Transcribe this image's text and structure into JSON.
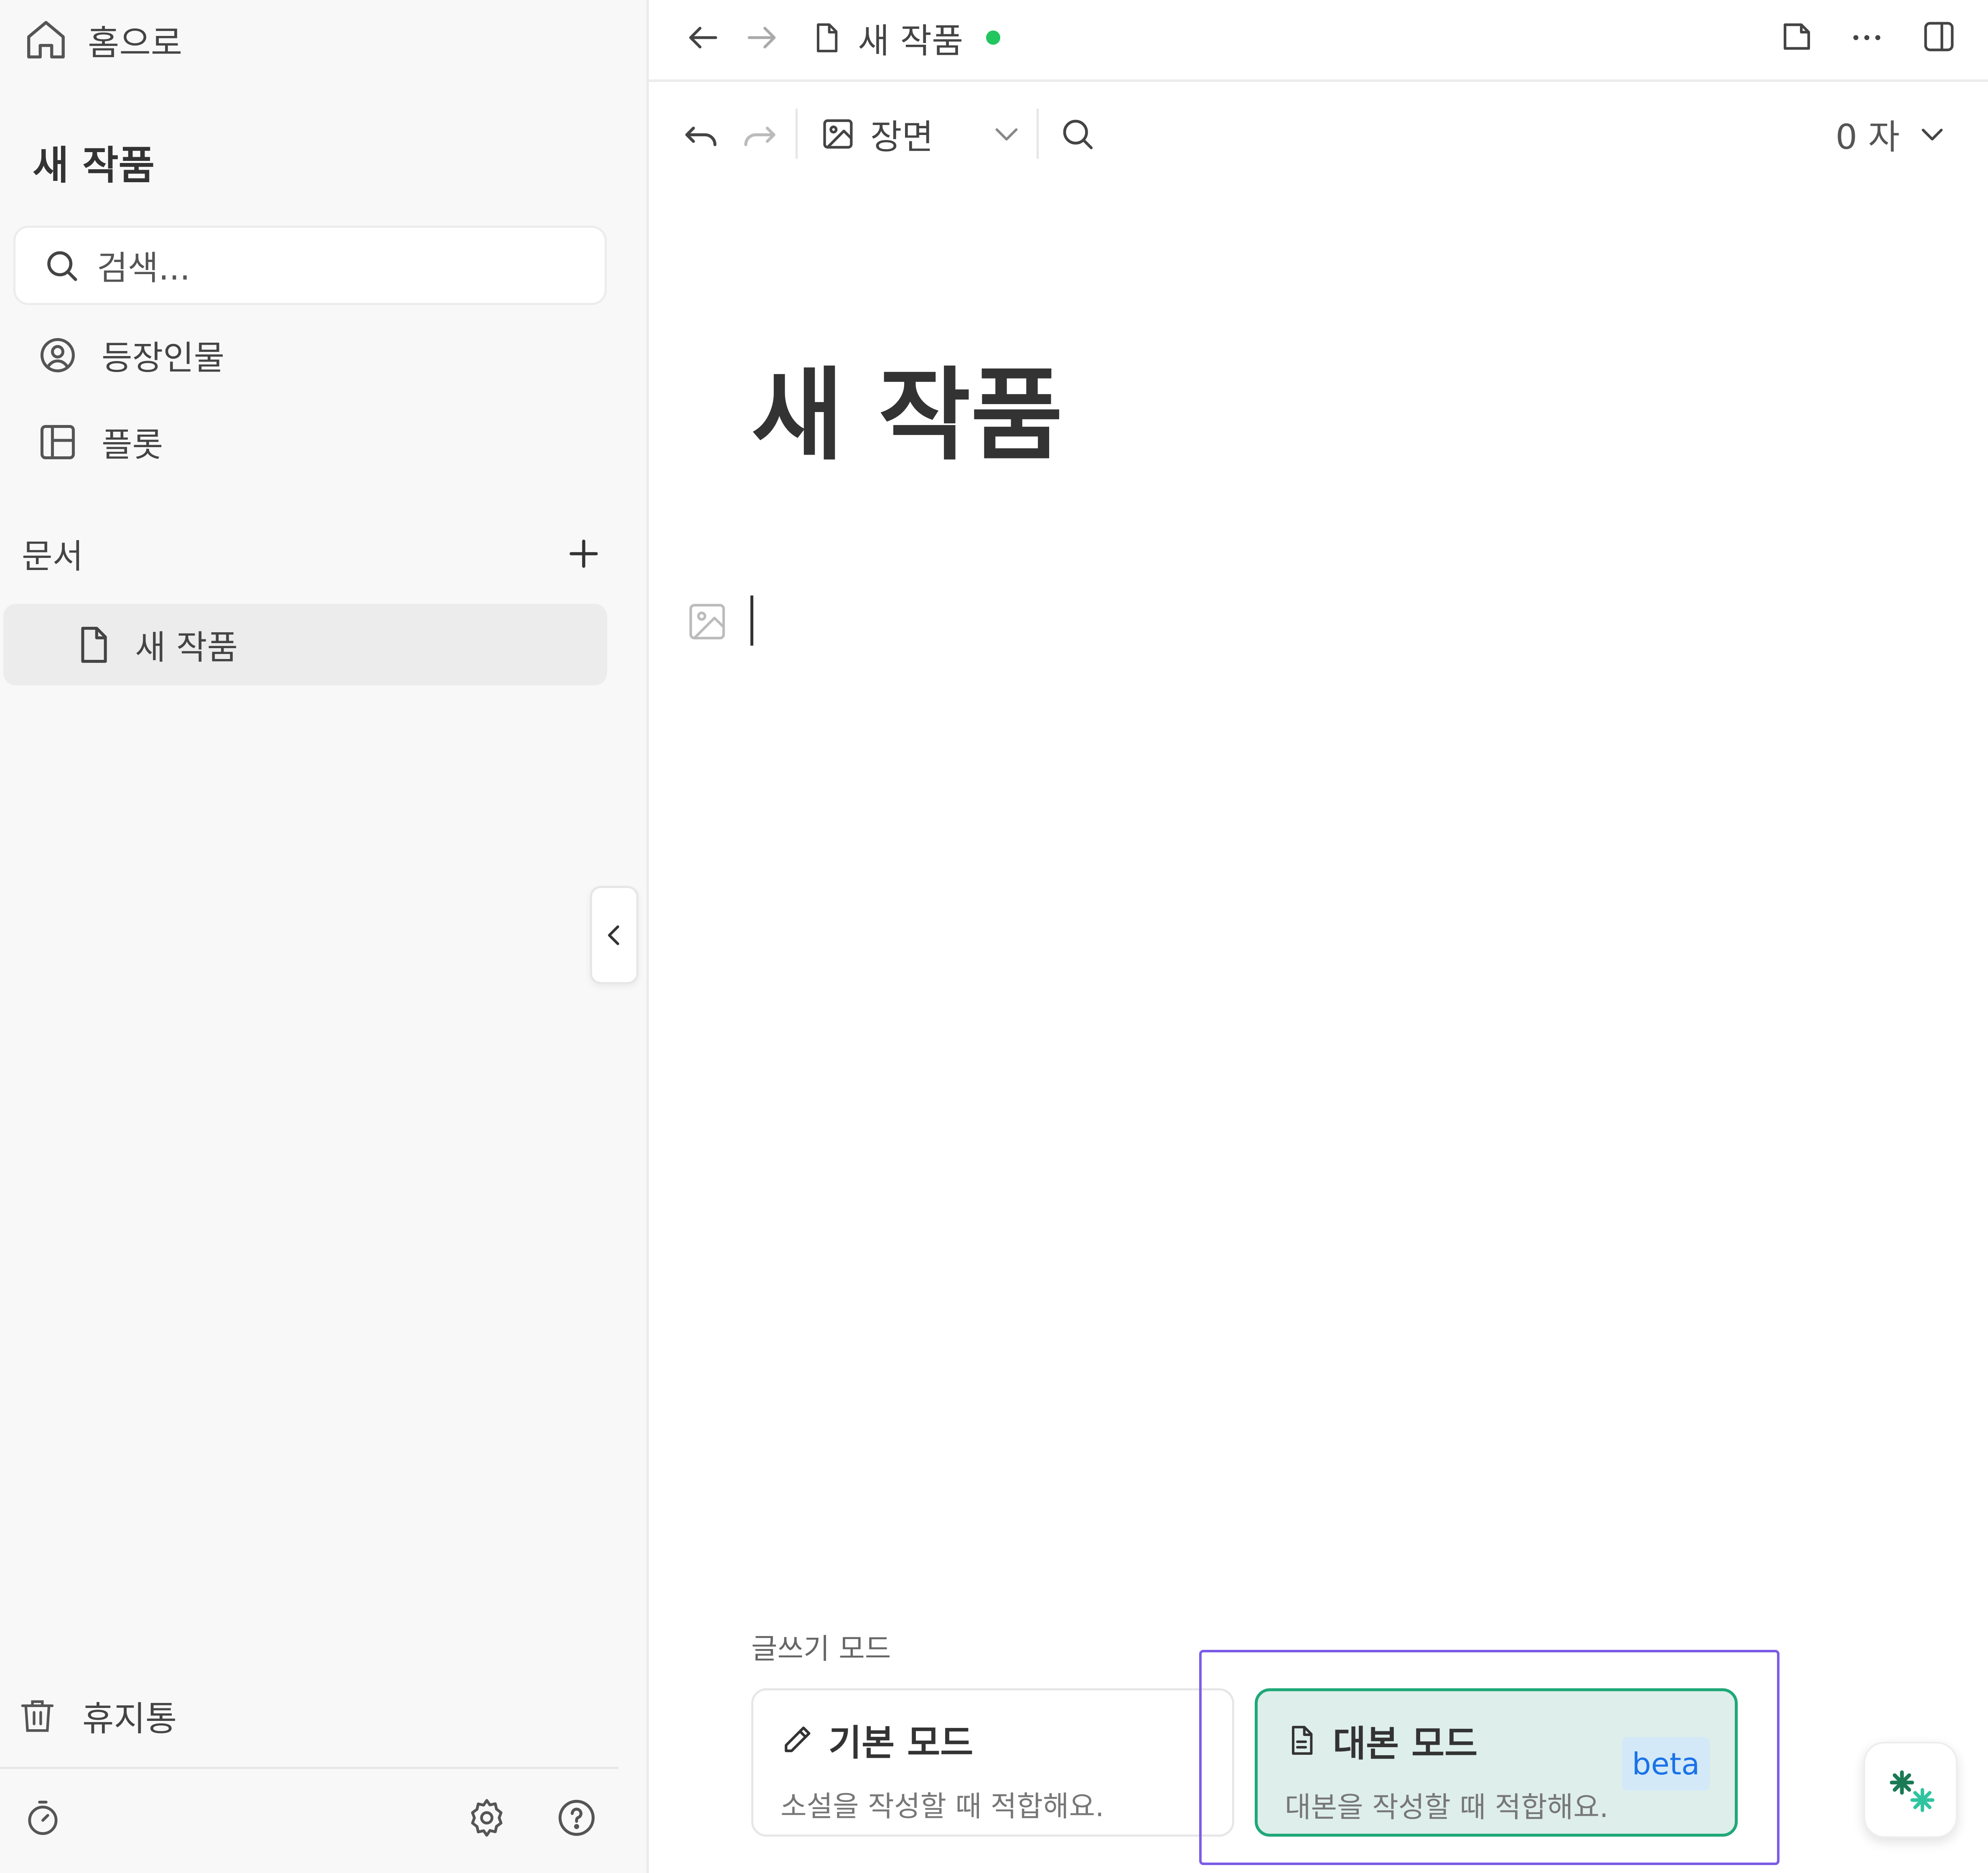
{
  "sidebar": {
    "home_label": "홈으로",
    "project_title": "새 작품",
    "search_placeholder": "검색...",
    "nav": [
      {
        "label": "등장인물",
        "icon": "user-circle-icon"
      },
      {
        "label": "플롯",
        "icon": "layout-icon"
      }
    ],
    "docs_heading": "문서",
    "documents": [
      {
        "label": "새 작품",
        "icon": "file-icon",
        "selected": true
      }
    ],
    "trash_label": "휴지통"
  },
  "header": {
    "doc_tab_title": "새 작품",
    "status_color": "#22c55e"
  },
  "toolbar": {
    "block_type": "장면",
    "word_count": "0 자"
  },
  "editor": {
    "title": "새 작품"
  },
  "writing_mode": {
    "label": "글쓰기 모드",
    "options": [
      {
        "title": "기본 모드",
        "description": "소설을 작성할 때 적합해요.",
        "icon": "pencil-icon",
        "selected": false
      },
      {
        "title": "대본 모드",
        "description": "대본을 작성할 때 적합해요.",
        "icon": "file-text-icon",
        "badge": "beta",
        "selected": true
      }
    ]
  },
  "colors": {
    "accent": "#1fa878",
    "selected_card_bg": "#deeeea",
    "highlight": "#7c5ce6",
    "badge_text": "#1a73e8"
  }
}
